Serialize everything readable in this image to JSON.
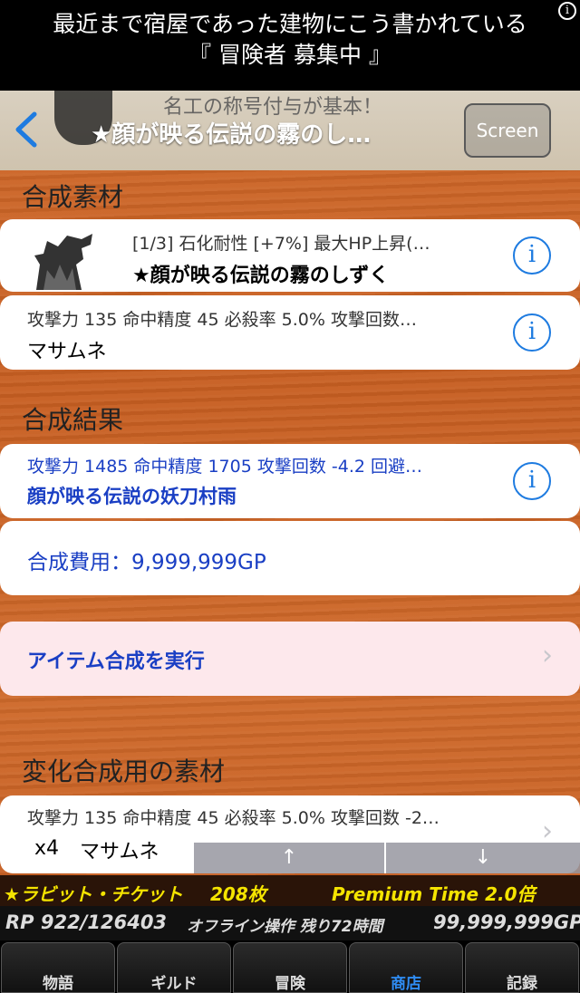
{
  "banner": {
    "line1": "最近まで宿屋であった建物にこう書かれている",
    "line2": "『 冒険者 募集中 』",
    "info_glyph": "i"
  },
  "navbar": {
    "bg_text": "名工の称号付与が基本！",
    "title": "★顔が映る伝説の霧のし…",
    "screen_label": "Screen"
  },
  "sections": {
    "materials": "合成素材",
    "result": "合成結果",
    "change": "変化合成用の素材"
  },
  "materials": [
    {
      "sub": "[1/3] 石化耐性 [+7%] 最大HP上昇(…",
      "name": "★顔が映る伝説の霧のしずく"
    },
    {
      "sub": "攻撃力 135 命中精度 45 必殺率 5.0% 攻撃回数…",
      "name": "マサムネ"
    }
  ],
  "result": {
    "sub": "攻撃力 1485 命中精度 1705 攻撃回数 -4.2 回避…",
    "name": "顔が映る伝説の妖刀村雨",
    "cost": "合成費用：9,999,999GP"
  },
  "execute_label": "アイテム合成を実行",
  "change_item": {
    "sub": "攻撃力 135 命中精度 45 必殺率 5.0% 攻撃回数 -2…",
    "qty": "x4",
    "name": "マサムネ"
  },
  "arrows": {
    "up": "↑",
    "down": "↓"
  },
  "ticket": {
    "label": "★ラビット・チケット",
    "count": "208枚",
    "premium": "Premium Time 2.0倍"
  },
  "status": {
    "rp": "RP 922/126403",
    "offline": "オフライン操作 残り72時間",
    "gp": "99,999,999GP"
  },
  "tabs": [
    "物語",
    "ギルド",
    "冒険",
    "商店",
    "記録"
  ],
  "colors": {
    "accent": "#1e7be0",
    "link": "#1a3fc4",
    "execute_bg": "#fde8ec",
    "ticket_yellow": "#f5e400",
    "active_tab": "#2f8df5"
  }
}
